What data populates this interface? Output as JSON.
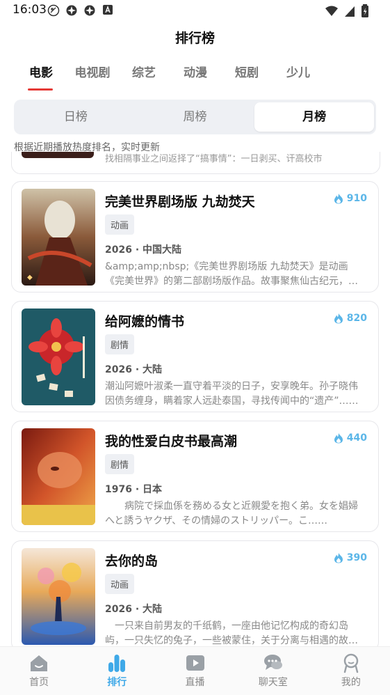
{
  "status": {
    "time": "16:03"
  },
  "header": {
    "title": "排行榜"
  },
  "categories": [
    "电影",
    "电视剧",
    "综艺",
    "动漫",
    "短剧",
    "少儿"
  ],
  "active_category": 0,
  "periods": [
    "日榜",
    "周榜",
    "月榜"
  ],
  "active_period": 2,
  "subtitle": "根据近期播放热度排名，实时更新",
  "previous_card_text": "找相隔事业之间返择了“搞事情”：一日剥买、讦高校市",
  "items": [
    {
      "title": "完美世界剧场版 九劫焚天",
      "heat": "910",
      "tag": "动画",
      "meta": "2026 · 中国大陆",
      "desc": "&amp;amp;nbsp;《完美世界剧场版 九劫焚天》是动画《完美世界》的第二部剧场版作品。故事聚焦仙古纪元，讲述石昊历经劫难、焚天而战的传奇。"
    },
    {
      "title": "给阿嬷的情书",
      "heat": "820",
      "tag": "剧情",
      "meta": "2026 · 大陆",
      "desc": "潮汕阿嬷叶淑柔一直守着平淡的日子，安享晚年。孙子晓伟因债务缠身，瞒着家人远赴泰国，寻找传闻中的“遗产”……"
    },
    {
      "title": "我的性爱白皮书最高潮",
      "heat": "440",
      "tag": "剧情",
      "meta": "1976 · 日本",
      "desc": "　　病院で採血係を務める女と近親愛を抱く弟。女を娼婦へと誘うヤクザ、その情婦のストリッパー。こ……"
    },
    {
      "title": "去你的岛",
      "heat": "390",
      "tag": "动画",
      "meta": "2026 · 大陆",
      "desc": "　一只来自前男友的千纸鹤，一座由他记忆构成的奇幻岛屿，一只失忆的兔子，一些被蒙住，关于分离与相遇的故事。"
    }
  ],
  "bottom_nav": [
    {
      "label": "首页",
      "icon": "home-icon"
    },
    {
      "label": "排行",
      "icon": "ranking-icon"
    },
    {
      "label": "直播",
      "icon": "live-icon"
    },
    {
      "label": "聊天室",
      "icon": "chat-icon"
    },
    {
      "label": "我的",
      "icon": "profile-icon"
    }
  ],
  "active_nav": 1,
  "colors": {
    "accent_red": "#e53935",
    "heat_blue": "#5bb6e8",
    "nav_active": "#3fa9e8"
  }
}
